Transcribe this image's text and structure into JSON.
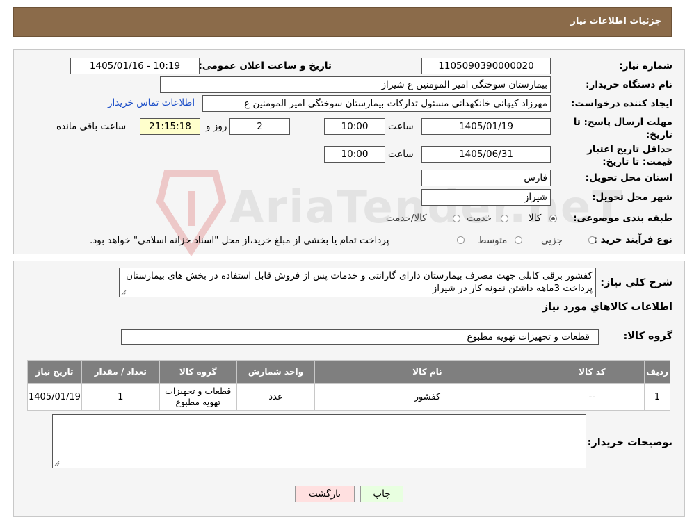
{
  "header": {
    "title": "جزئیات اطلاعات نیاز"
  },
  "watermark": {
    "text": "AriaTender.neT"
  },
  "fields": {
    "need_number_label": "شماره نیاز:",
    "need_number": "1105090390000020",
    "announce_label": "تاریخ و ساعت اعلان عمومی:",
    "announce_value": "1405/01/16 - 10:19",
    "buyer_org_label": "نام دستگاه خریدار:",
    "buyer_org": "بیمارستان سوختگی امیر المومنین  ع  شیراز",
    "creator_label": "ایجاد کننده درخواست:",
    "creator": "مهرزاد کیهانی خانکهدانی مسئول تدارکات بیمارستان سوختگی امیر المومنین  ع",
    "contact_link": "اطلاعات تماس خریدار",
    "deadline_label": "مهلت ارسال پاسخ: تا تاریخ:",
    "deadline_date": "1405/01/19",
    "time_label": "ساعت",
    "deadline_time": "10:00",
    "days_value": "2",
    "days_label": "روز و",
    "remaining_time": "21:15:18",
    "remaining_label": "ساعت باقی مانده",
    "validity_label": "حداقل تاریخ اعتبار قیمت: تا تاریخ:",
    "validity_date": "1405/06/31",
    "validity_time": "10:00",
    "province_label": "استان محل تحویل:",
    "province": "فارس",
    "city_label": "شهر محل تحویل:",
    "city": "شیراز",
    "category_label": "طبقه بندی موضوعی:",
    "category_options": [
      "کالا",
      "خدمت",
      "کالا/خدمت"
    ],
    "category_selected": "کالا",
    "process_label": "نوع فرآیند خرید :",
    "process_options": [
      "جزیی",
      "متوسط"
    ],
    "process_note": "پرداخت تمام یا بخشی از مبلغ خرید،از محل \"اسناد خزانه اسلامی\" خواهد بود."
  },
  "description": {
    "label": "شرح کلي نياز:",
    "text": "کفشور برقی کابلی جهت مصرف بیمارستان دارای گارانتی و خدمات پس از فروش قابل استفاده در بخش های بیمارستان پرداخت 3ماهه داشتن نمونه کار در شیراز"
  },
  "goods": {
    "section_title": "اطلاعات کالاهاي مورد نياز",
    "group_label": "گروه کالا:",
    "group_value": "قطعات و تجهیزات تهویه مطبوع",
    "columns": [
      "ردیف",
      "کد کالا",
      "نام کالا",
      "واحد شمارش",
      "گروه کالا",
      "تعداد / مقدار",
      "تاریخ نیاز"
    ],
    "rows": [
      [
        "1",
        "--",
        "کفشور",
        "عدد",
        "قطعات و تجهیزات تهویه مطبوع",
        "1",
        "1405/01/19"
      ]
    ]
  },
  "buyer_notes": {
    "label": "توضیحات خریدار:",
    "value": ""
  },
  "buttons": {
    "print": "چاپ",
    "back": "بازگشت"
  },
  "colors": {
    "header_bg": "#8b6b4a",
    "table_header_bg": "#7f7f7f",
    "remaining_bg": "#ffffcc",
    "link": "#1e50c8",
    "back_bg": "#ffe0e0",
    "print_bg": "#e8ffe0"
  }
}
